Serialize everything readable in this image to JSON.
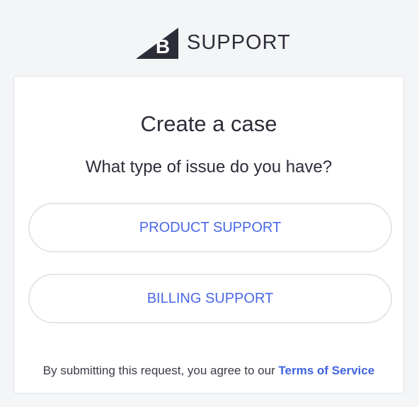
{
  "header": {
    "logo_icon": "bigcommerce-b-logo-icon",
    "logo_letter": "B",
    "brand_text": "SUPPORT"
  },
  "card": {
    "title": "Create a case",
    "question": "What type of issue do you have?",
    "options": [
      {
        "label": "PRODUCT SUPPORT"
      },
      {
        "label": "BILLING SUPPORT"
      }
    ],
    "terms": {
      "prefix": "By submitting this request, you agree to our ",
      "link_label": "Terms of Service"
    }
  },
  "colors": {
    "background": "#f4f5f7",
    "text": "#2d2d3a",
    "accent": "#4a68e6",
    "card_border": "#dfe2e8"
  }
}
